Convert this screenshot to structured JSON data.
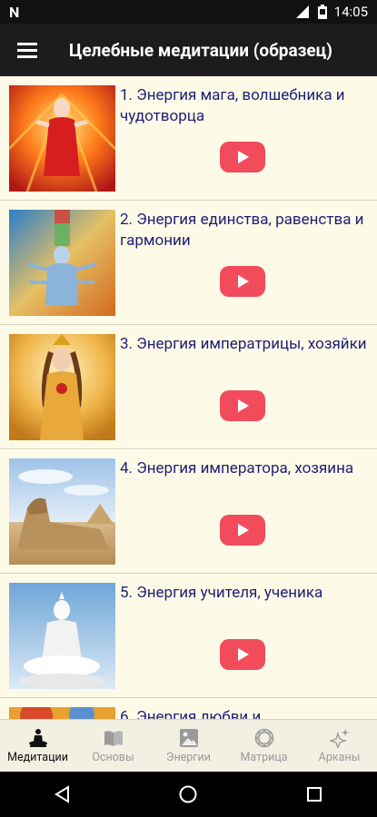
{
  "status_bar": {
    "time": "14:05",
    "left_icon": "n-logo-icon"
  },
  "app_bar": {
    "menu_icon": "hamburger-icon",
    "title": "Целебные медитации (образец)"
  },
  "items": [
    {
      "title": "1. Энергия мага, волшебника и чудотворца",
      "thumb": "mage-image"
    },
    {
      "title": "2. Энергия единства, равенства и гармонии",
      "thumb": "unity-image"
    },
    {
      "title": "3. Энергия императрицы, хозяйки",
      "thumb": "empress-image"
    },
    {
      "title": "4. Энергия императора, хозяина",
      "thumb": "sphinx-image"
    },
    {
      "title": "5. Энергия учителя, ученика",
      "thumb": "buddha-image"
    },
    {
      "title": "6. Энергия любви и",
      "thumb": "love-image"
    }
  ],
  "bottom_nav": [
    {
      "label": "Медитации",
      "icon": "meditation-icon",
      "active": true
    },
    {
      "label": "Основы",
      "icon": "book-icon",
      "active": false
    },
    {
      "label": "Энергии",
      "icon": "image-icon",
      "active": false
    },
    {
      "label": "Матрица",
      "icon": "matrix-icon",
      "active": false
    },
    {
      "label": "Арканы",
      "icon": "sparkles-icon",
      "active": false
    }
  ],
  "colors": {
    "accent_play": "#f24b5b",
    "title_text": "#1f1f75",
    "list_bg": "#fdfbe8"
  }
}
